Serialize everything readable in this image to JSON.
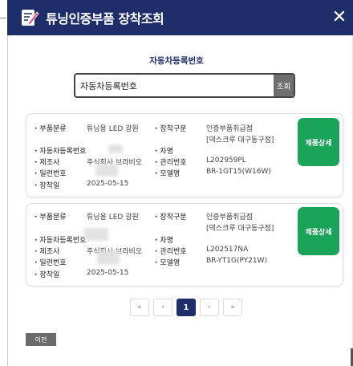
{
  "header": {
    "title": "튜닝인증부품 장착조회",
    "close_label": "✕"
  },
  "search": {
    "section_title": "자동차등록번호",
    "value": "자동차등록번호",
    "button_label": "조회"
  },
  "labels": {
    "part_type": "부품분류",
    "install_type": "장착구분",
    "car_number": "자동차등록번호",
    "car_name": "차명",
    "maker": "제조사",
    "manage_no": "관리번호",
    "serial": "일련번호",
    "model": "모델명",
    "install_date": "장착일"
  },
  "results": [
    {
      "part_type": "튜닝용 LED 광원",
      "install_type_line1": "인증부품취급점",
      "install_type_line2": "[덱스크루 대구동구점]",
      "maker": "주식회사 브라비오",
      "manage_no": "L202959PL",
      "model": "BR-1GT15(W16W)",
      "install_date": "2025-05-15",
      "detail_label": "제품상세"
    },
    {
      "part_type": "튜닝용 LED 광원",
      "install_type_line1": "인증부품취급점",
      "install_type_line2": "[덱스크루 대구동구점]",
      "maker": "주식회사 브라비오",
      "manage_no": "L202517NA",
      "model": "BR-YT1G(PY21W)",
      "install_date": "2025-05-15",
      "detail_label": "제품상세"
    }
  ],
  "pagination": {
    "first": "«",
    "prev": "‹",
    "current": "1",
    "next": "›",
    "last": "»"
  },
  "footer": {
    "prev_label": "이전"
  },
  "colors": {
    "header": "#1e2e6a",
    "detail_button": "#1aa45a",
    "search_button": "#6e6e6e"
  }
}
